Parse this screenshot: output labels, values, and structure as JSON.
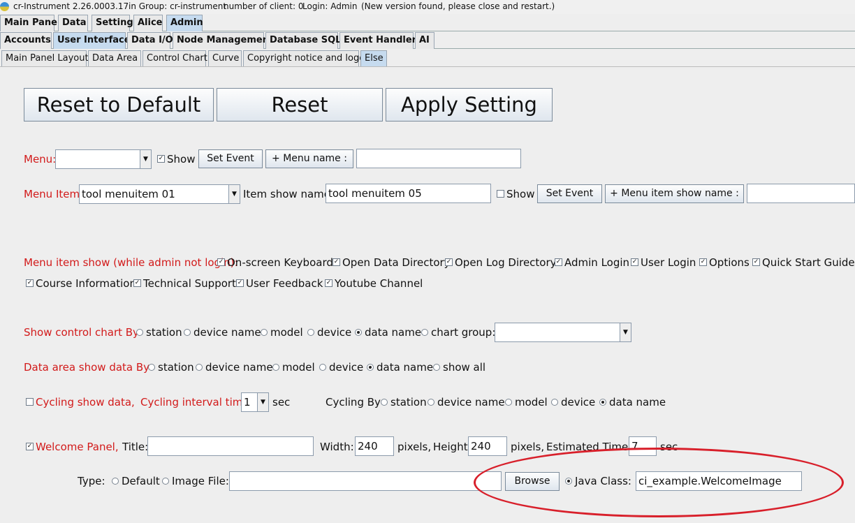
{
  "titlebar": {
    "app": "cr-Instrument 2.26.0003.17",
    "group": "in Group: cr-instrument",
    "clients": "number of client: 0",
    "login": "Login: Admin",
    "notice": "(New version found, please close and restart.)"
  },
  "tabs_main": [
    "Main Panel",
    "Data",
    "Setting",
    "Alice",
    "Admin"
  ],
  "tabs_admin": [
    "Accounts",
    "User Interface",
    "Data I/O",
    "Node Management",
    "Database SQL",
    "Event Handler",
    "AI"
  ],
  "tabs_ui": [
    "Main Panel Layout",
    "Data Area",
    "Control Chart",
    "Curve",
    "Copyright notice and logo",
    "Else"
  ],
  "buttons": {
    "reset_default": "Reset to Default",
    "reset": "Reset",
    "apply": "Apply Setting",
    "set_event": "Set Event",
    "menu_name": "+ Menu name :",
    "menu_item_show_name": "+ Menu item show name :",
    "browse": "Browse"
  },
  "menu": {
    "label": "Menu:",
    "show": "Show",
    "show_checked": true,
    "value": "",
    "name_value": ""
  },
  "menu_item": {
    "label": "Menu Item:",
    "value": "tool menuitem 01",
    "show_name_label": "Item show name:",
    "show_name_value": "tool menuitem 05",
    "show": "Show",
    "show_checked": false,
    "extra_value": ""
  },
  "menu_item_show": {
    "label": "Menu item show (while admin not login):",
    "items": [
      "On-screen Keyboard",
      "Open Data Directory",
      "Open Log Directory",
      "Admin Login",
      "User Login",
      "Options",
      "Quick Start Guide",
      "Course Information",
      "Technical Support",
      "User Feedback",
      "Youtube Channel"
    ]
  },
  "control_chart": {
    "label": "Show control chart  By",
    "options": [
      "station",
      "device name",
      "model",
      "device",
      "data name",
      "chart group:"
    ],
    "selected": "data name",
    "group_value": ""
  },
  "data_area": {
    "label": "Data area show data  By",
    "options": [
      "station",
      "device name",
      "model",
      "device",
      "data name",
      "show all"
    ],
    "selected": "data name"
  },
  "cycling": {
    "label": "Cycling show data,",
    "checked": false,
    "interval_label": "Cycling interval time:",
    "interval_value": "1",
    "unit": "sec",
    "by_label": "Cycling By",
    "options": [
      "station",
      "device name",
      "model",
      "device",
      "data name"
    ],
    "selected": "data name"
  },
  "welcome": {
    "label": "Welcome Panel,",
    "checked": true,
    "title_label": "Title:",
    "title_value": "",
    "width_label": "Width:",
    "width_value": "240",
    "pixels1": "pixels,",
    "height_label": "Height:",
    "height_value": "240",
    "pixels2": "pixels,",
    "est_label": "Estimated Time:",
    "est_value": "7",
    "est_unit": "sec",
    "type_label": "Type:",
    "type_default": "Default",
    "type_image": "Image File:",
    "image_value": "",
    "type_java": "Java Class:",
    "java_value": "ci_example.WelcomeImage",
    "selected_type": "Java Class"
  },
  "colors": {
    "label_red": "#d21a1a",
    "tab_selected": "#c6dbef",
    "highlight_ellipse": "#d81f2a"
  }
}
